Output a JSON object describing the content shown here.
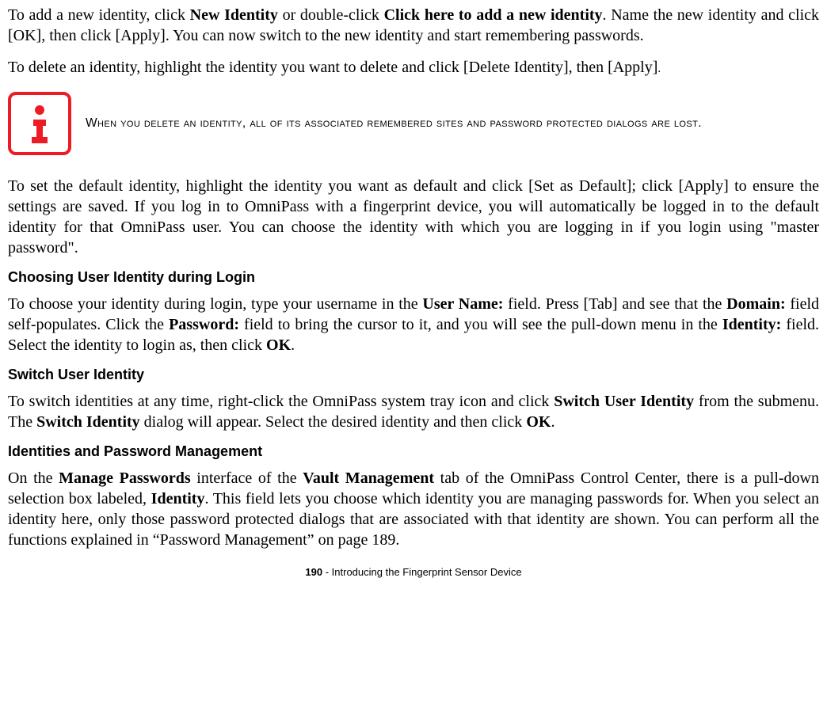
{
  "para_add_identity": {
    "pre1": "To add a new identity, click ",
    "bold1": "New Identity",
    "mid1": " or double-click ",
    "bold2": "Click here to add a new identity",
    "post": ". Name the new identity and click [OK], then click [Apply]. You can now switch to the new identity and start remembering passwords."
  },
  "para_delete_identity": {
    "main": "To delete an identity, highlight the identity you want to delete and click [Delete Identity], then [Apply]",
    "small": "."
  },
  "note": "When you delete an identity, all of its associated remembered sites and password protected dialogs are lost.",
  "para_set_default": "To set the default identity, highlight the identity you want as default and click [Set as Default]; click [Apply] to ensure the settings are saved. If you log in to OmniPass with a fingerprint device, you will automatically be logged in to the default identity for that OmniPass user. You can choose the identity with which you are logging in if you login using \"master password\".",
  "heading_choose": "Choosing User Identity during Login",
  "para_choose": {
    "s1": "To choose your identity during login, type your username in the ",
    "b1": "User Name:",
    "s2": " field. Press [Tab] and see that the ",
    "b2": "Domain:",
    "s3": " field self-populates. Click the ",
    "b3": "Password:",
    "s4": " field to bring the cursor to it, and you will see the pull-down menu in the ",
    "b4": "Identity:",
    "s5": " field. Select the identity to login as, then click ",
    "b5": "OK",
    "s6": "."
  },
  "heading_switch": "Switch User Identity",
  "para_switch": {
    "s1": "To switch identities at any time, right-click the OmniPass system tray icon and click ",
    "b1": "Switch User Identity",
    "s2": " from the submenu. The ",
    "b2": "Switch Identity",
    "s3": " dialog will appear. Select the desired identity and then click ",
    "b3": "OK",
    "s4": "."
  },
  "heading_pwmgmt": "Identities and Password Management",
  "para_pwmgmt": {
    "s1": "On the ",
    "b1": "Manage Passwords",
    "s2": " interface of the ",
    "b2": "Vault Management",
    "s3": " tab of the OmniPass Control Center, there is a pull-down selection box labeled, ",
    "b3": "Identity",
    "s4": ". This field lets you choose which identity you are managing passwords for. When you select an identity here, only those password protected dialogs that are associated with that identity are shown. You can perform all the functions explained in “Password Management” on page 189."
  },
  "footer": {
    "pagenum": "190",
    "sep": " - ",
    "title": "Introducing the Fingerprint Sensor Device"
  }
}
